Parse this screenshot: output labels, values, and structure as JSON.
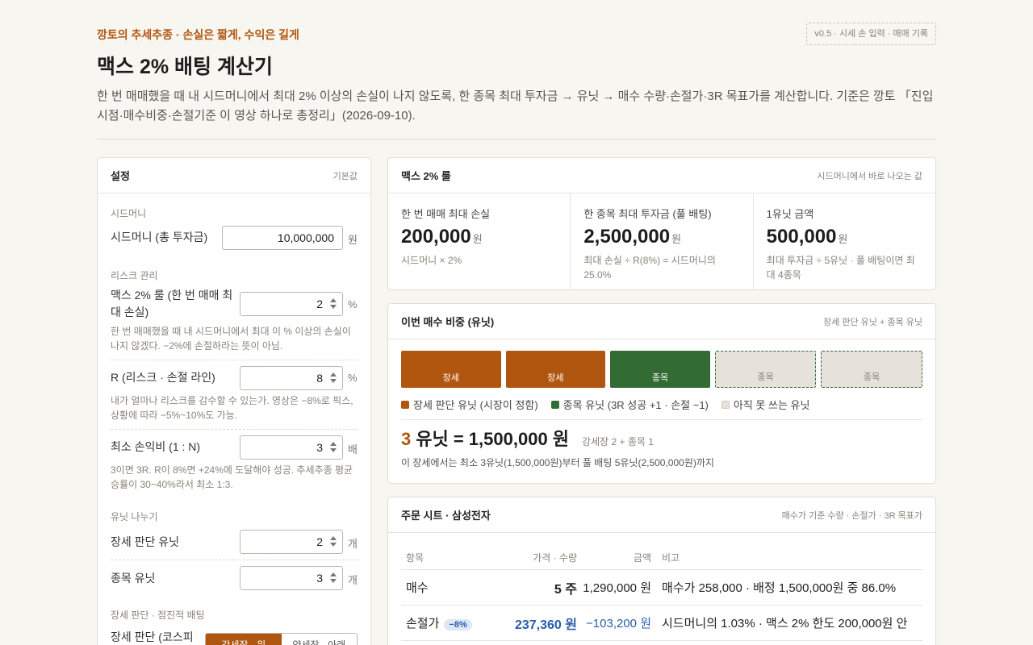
{
  "header": {
    "eyebrow": "깡토의 추세추종 · 손실은 짧게, 수익은 길게",
    "version": "v0.5 · 시세 손 입력 · 매매 기록",
    "title": "맥스 2% 배팅 계산기",
    "intro": "한 번 매매했을 때 내 시드머니에서 최대 2% 이상의 손실이 나지 않도록, 한 종목 최대 투자금 → 유닛 → 매수 수량·손절가·3R 목표가를 계산합니다. 기준은 깡토 「진입시점·매수비중·손절기준 이 영상 하나로 총정리」(2026-09-10)."
  },
  "settings": {
    "title": "설정",
    "sub": "기본값",
    "seed_section": "시드머니",
    "seed_label": "시드머니 (총 투자금)",
    "seed_value": "10,000,000",
    "seed_unit": "원",
    "risk_section": "리스크 관리",
    "max_label": "맥스 2% 룰 (한 번 매매 최대 손실)",
    "max_value": "2",
    "max_unit": "%",
    "max_help": "한 번 매매했을 때 내 시드머니에서 최대 이 % 이상의 손실이 나지 않겠다. −2%에 손절하라는 뜻이 아님.",
    "r_label": "R (리스크 · 손절 라인)",
    "r_value": "8",
    "r_unit": "%",
    "r_help": "내가 얼마나 리스크를 감수할 수 있는가. 영상은 −8%로 픽스, 상황에 따라 −5%~10%도 가능.",
    "rr_label": "최소 손익비 (1 : N)",
    "rr_value": "3",
    "rr_unit": "배",
    "rr_help": "3이면 3R. R이 8%면 +24%에 도달해야 성공. 추세추종 평균 승률이 30~40%라서 최소 1:3.",
    "unit_section": "유닛 나누기",
    "market_unit_label": "장세 판단 유닛",
    "market_unit_value": "2",
    "market_unit_unit": "개",
    "stock_unit_label": "종목 유닛",
    "stock_unit_value": "3",
    "stock_unit_unit": "개",
    "market_section": "장세 판단 · 점진적 배팅",
    "market_label": "장세 판단 (코스피",
    "seg_on": "강세장 · 위",
    "seg_off": "약세장 · 아래"
  },
  "max2": {
    "title": "맥스 2% 룰",
    "sub": "시드머니에서 바로 나오는 값",
    "stats": [
      {
        "label": "한 번 매매 최대 손실",
        "value": "200,000",
        "unit": "원",
        "note": "시드머니 × 2%"
      },
      {
        "label": "한 종목 최대 투자금 (풀 배팅)",
        "value": "2,500,000",
        "unit": "원",
        "note": "최대 손실 ÷ R(8%) = 시드머니의 25.0%"
      },
      {
        "label": "1유닛 금액",
        "value": "500,000",
        "unit": "원",
        "note": "최대 투자금 ÷ 5유닛 · 풀 배팅이면 최대 4종목"
      }
    ]
  },
  "units": {
    "title": "이번 매수 비중 (유닛)",
    "sub": "장세 판단 유닛 + 종목 유닛",
    "blocks": [
      "장세",
      "장세",
      "종목",
      "종목",
      "종목"
    ],
    "legend": [
      "장세 판단 유닛 (시장이 정함)",
      "종목 유닛 (3R 성공 +1 · 손절 −1)",
      "아직 못 쓰는 유닛"
    ],
    "total_num": "3",
    "total_text": "유닛 = 1,500,000 원",
    "total_break": "강세장 2 + 종목 1",
    "note": "이 장세에서는 최소 3유닛(1,500,000원)부터 풀 배팅 5유닛(2,500,000원)까지"
  },
  "order": {
    "title": "주문 시트 · 삼성전자",
    "sub": "매수가 기준 수량 · 손절가 · 3R 목표가",
    "headers": [
      "항목",
      "가격 · 수량",
      "금액",
      "비고"
    ],
    "rows": [
      {
        "item": "매수",
        "qty": "5 주",
        "amount": "1,290,000 원",
        "note": "매수가 258,000 · 배정 1,500,000원 중 86.0%"
      },
      {
        "item": "손절가",
        "badge": "−8%",
        "qty": "237,360 원",
        "amount": "−103,200 원",
        "note": "시드머니의 1.03% · 맥스 2% 한도 200,000원 안"
      }
    ]
  },
  "colors": {
    "accent": "#b0560f",
    "stock": "#326b34",
    "loss": "#2a5ea8"
  }
}
